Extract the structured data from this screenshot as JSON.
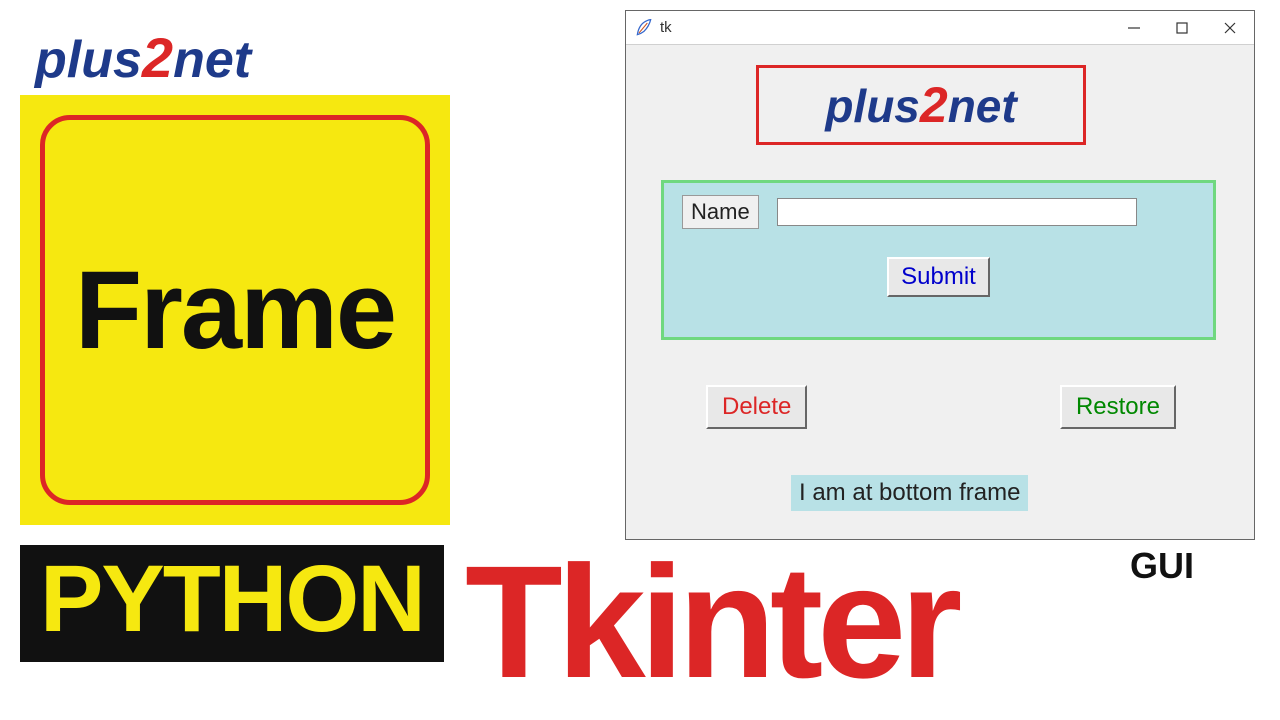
{
  "branding": {
    "logo_part1": "plus",
    "logo_part2": "2",
    "logo_part3": "net"
  },
  "left_panel": {
    "frame_label": "Frame",
    "python_label": "PYTHON",
    "tkinter_label": "Tkinter",
    "gui_label": "GUI"
  },
  "tk_window": {
    "title": "tk",
    "logo_part1": "plus",
    "logo_part2": "2",
    "logo_part3": "net",
    "form": {
      "name_label": "Name",
      "name_value": "",
      "submit_label": "Submit"
    },
    "buttons": {
      "delete_label": "Delete",
      "restore_label": "Restore"
    },
    "bottom_text": "I am at  bottom frame"
  }
}
